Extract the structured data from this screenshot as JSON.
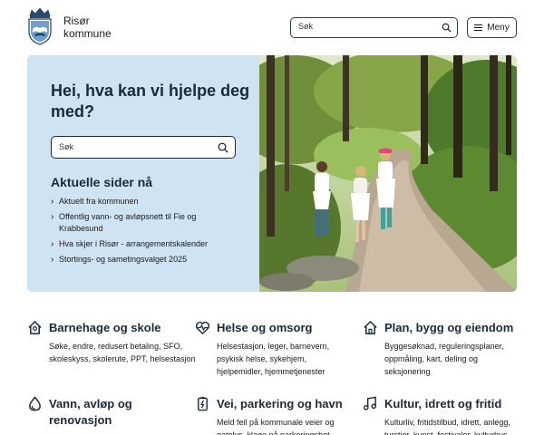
{
  "header": {
    "brand_line1": "Risør",
    "brand_line2": "kommune",
    "search_placeholder": "Søk",
    "menu_label": "Meny"
  },
  "hero": {
    "title": "Hei, hva kan vi hjelpe deg med?",
    "search_placeholder": "Søk",
    "aktuelle_heading": "Aktuelle sider nå",
    "links": [
      "Aktuelt fra kommunen",
      "Offentlig vann- og avløpsnett til Fie og Krabbesund",
      "Hva skjer i Risør - arrangementskalender",
      "Stortings- og sametingsvalget 2025"
    ]
  },
  "categories": [
    {
      "title": "Barnehage og skole",
      "desc": "Søke, endre, redusert betaling, SFO, skoleskyss, skolerute, PPT, helsestasjon",
      "icon": "house-child-icon"
    },
    {
      "title": "Helse og omsorg",
      "desc": "Helsestasjon, leger, barnevern, psykisk helse, sykehjem, hjelpemidler, hjemmetjenester",
      "icon": "heart-pulse-icon"
    },
    {
      "title": "Plan, bygg og eiendom",
      "desc": "Byggesøknad, reguleringsplaner, oppmåling, kart, deling og seksjonering",
      "icon": "house-icon"
    },
    {
      "title": "Vann, avløp og renovasjon",
      "desc": "",
      "icon": "water-drop-icon"
    },
    {
      "title": "Vei, parkering og havn",
      "desc": "Meld feil på kommunale veier og gatelys, klage på parkeringsbot",
      "icon": "parking-meter-icon"
    },
    {
      "title": "Kultur, idrett og fritid",
      "desc": "Kulturliv, fritidstilbud, idrett, anlegg, turstier, kunst, festivaler, kulturhus",
      "icon": "music-note-icon"
    }
  ],
  "colors": {
    "accent_dark": "#1f3f62",
    "hero_bg": "#cfe3f2",
    "text": "#1a2a3a"
  }
}
